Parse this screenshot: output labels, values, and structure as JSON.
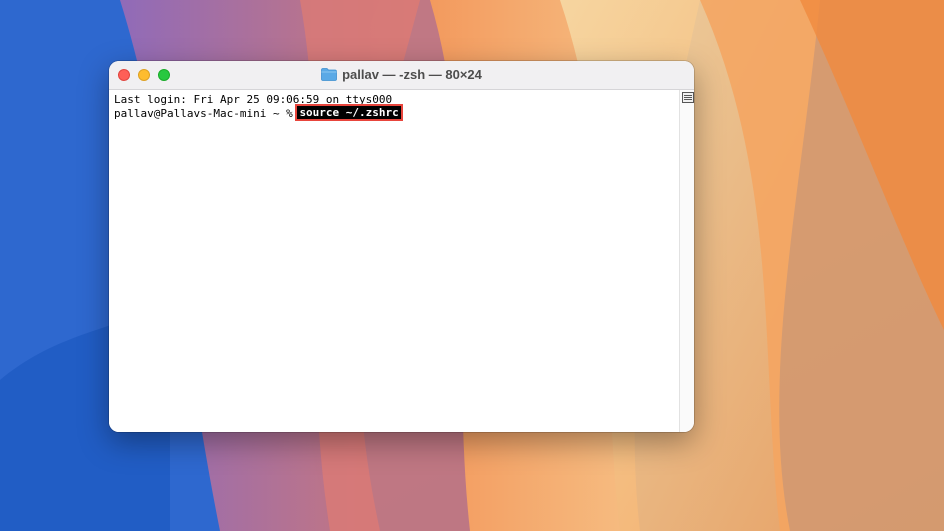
{
  "window": {
    "title": "pallav — -zsh — 80×24",
    "title_icon": "folder-icon",
    "controls": [
      "close",
      "minimize",
      "zoom"
    ]
  },
  "terminal": {
    "last_login": "Last login: Fri Apr 25 09:06:59 on ttys000",
    "prompt": "pallav@Pallavs-Mac-mini ~ % ",
    "command": "source ~/.zshrc",
    "command_highlight_color": "#e8453c"
  },
  "colors": {
    "close": "#fe5f57",
    "minimize": "#febc2e",
    "zoom": "#28c840",
    "selection_bg": "#000000",
    "selection_fg": "#ffffff"
  }
}
